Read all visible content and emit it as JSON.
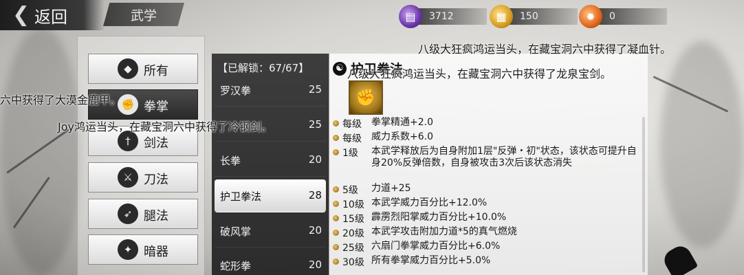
{
  "header": {
    "back_label": "返回",
    "section_title": "武学",
    "currencies": [
      {
        "icon": "purple-book-icon",
        "value": "3712",
        "color": "#7a46b8"
      },
      {
        "icon": "gold-token-icon",
        "value": "150",
        "color": "#d69b22"
      },
      {
        "icon": "fire-token-icon",
        "value": "0",
        "color": "#e0661c"
      }
    ]
  },
  "categories": [
    {
      "label": "所有",
      "icon": "all-icon",
      "glyph": "◆"
    },
    {
      "label": "拳掌",
      "icon": "fist-icon",
      "glyph": "✊"
    },
    {
      "label": "剑法",
      "icon": "sword-icon",
      "glyph": "†"
    },
    {
      "label": "刀法",
      "icon": "blade-icon",
      "glyph": "⚔"
    },
    {
      "label": "腿法",
      "icon": "leg-icon",
      "glyph": "➶"
    },
    {
      "label": "暗器",
      "icon": "dart-icon",
      "glyph": "✦"
    }
  ],
  "skill_list": {
    "header": "【已解锁：67/67】",
    "items": [
      {
        "name": "罗汉拳",
        "level": "25"
      },
      {
        "name": "",
        "level": "25"
      },
      {
        "name": "长拳",
        "level": "20"
      },
      {
        "name": "护卫拳法",
        "level": "28"
      },
      {
        "name": "破风掌",
        "level": "20"
      },
      {
        "name": "蛇形拳",
        "level": "20"
      }
    ]
  },
  "detail": {
    "title": "护卫拳法",
    "icon": "fist-skill-icon",
    "rows": [
      {
        "level": "每级",
        "text": "拳掌精通+2.0"
      },
      {
        "level": "每级",
        "text": "威力系数+6.0"
      },
      {
        "level": "1级",
        "text": "本武学释放后为自身附加1层\"反弹・初\"状态，该状态可提升自身20%反弹倍数，自身被攻击3次后该状态消失"
      },
      {
        "level": "5级",
        "text": "力道+25"
      },
      {
        "level": "10级",
        "text": "本武学威力百分比+12.0%"
      },
      {
        "level": "15级",
        "text": "霹雳烈阳掌威力百分比+10.0%"
      },
      {
        "level": "20级",
        "text": "本武学攻击附加力道*5的真气燃烧"
      },
      {
        "level": "25级",
        "text": "六扇门拳掌威力百分比+6.0%"
      },
      {
        "level": "30级",
        "text": "所有拳掌威力百分比+5.0%"
      }
    ]
  },
  "broadcasts": [
    "八级大狂疯鸿运当头，在藏宝洞六中获得了凝血针。",
    "八级大狂疯鸿运当头，在藏宝洞六中获得了龙泉宝剑。",
    "六中获得了大漠金鹿甲。",
    "Joy鸿运当头，在藏宝洞六中获得了冷钢剑。"
  ]
}
